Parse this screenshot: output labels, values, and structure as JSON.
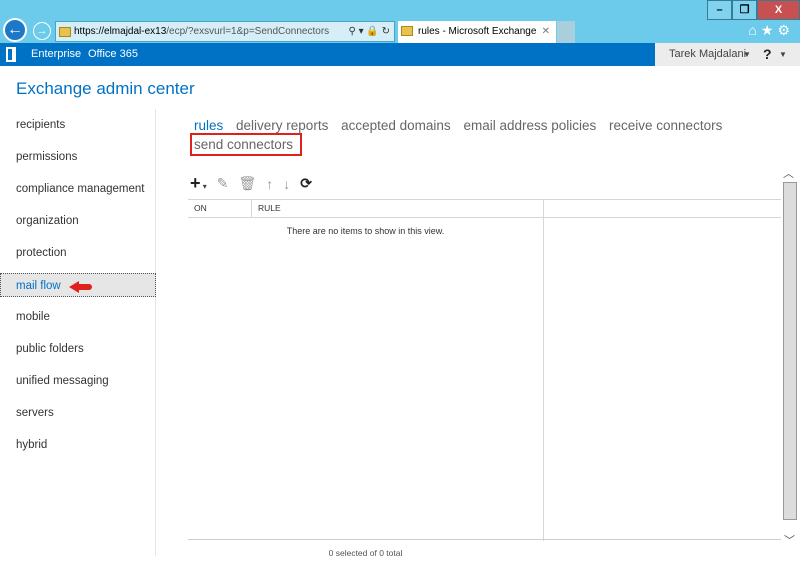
{
  "browser": {
    "url_host": "https://elmajdal-ex13",
    "url_path": "/ecp/?exsvurl=1&p=SendConnectors",
    "tab_title": "rules - Microsoft Exchange",
    "window_buttons": [
      "minimize",
      "restore",
      "close"
    ]
  },
  "nav": {
    "enterprise": "Enterprise",
    "office365": "Office 365",
    "user": "Tarek Majdalani",
    "help": "?"
  },
  "title": "Exchange admin center",
  "sidebar": {
    "items": [
      {
        "label": "recipients"
      },
      {
        "label": "permissions"
      },
      {
        "label": "compliance management"
      },
      {
        "label": "organization"
      },
      {
        "label": "protection"
      },
      {
        "label": "mail flow",
        "selected": true
      },
      {
        "label": "mobile"
      },
      {
        "label": "public folders"
      },
      {
        "label": "unified messaging"
      },
      {
        "label": "servers"
      },
      {
        "label": "hybrid"
      }
    ]
  },
  "tabs": [
    {
      "label": "rules",
      "active": true
    },
    {
      "label": "delivery reports"
    },
    {
      "label": "accepted domains"
    },
    {
      "label": "email address policies"
    },
    {
      "label": "receive connectors"
    },
    {
      "label": "send connectors",
      "highlighted": true
    }
  ],
  "toolbar": [
    "plus-icon",
    "edit-icon",
    "delete-icon",
    "move-up-icon",
    "move-down-icon",
    "refresh-icon"
  ],
  "table": {
    "columns": [
      "ON",
      "RULE"
    ],
    "empty_text": "There are no items to show in this view.",
    "footer": "0 selected of 0 total"
  },
  "colors": {
    "accent": "#0072c6",
    "highlight": "#e0201b",
    "chrome": "#6ccbea"
  }
}
